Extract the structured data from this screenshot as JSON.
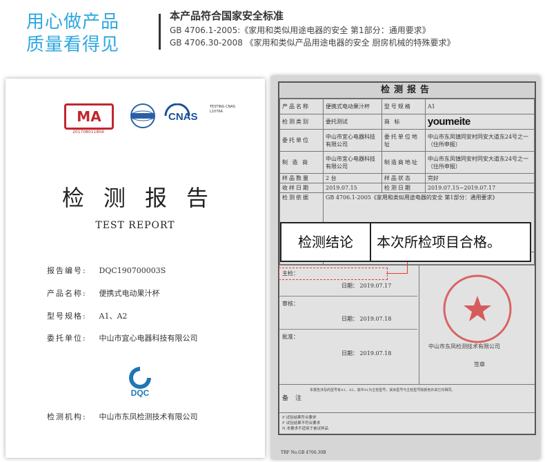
{
  "header": {
    "slogan_line1": "用心做产品",
    "slogan_line2": "质量看得见",
    "standards_title": "本产品符合国家安全标准",
    "standard_1": "GB 4706.1-2005:《家用和类似用途电器的安全 第1部分：通用要求》",
    "standard_2": "GB 4706.30-2008 《家用和类似产品用途电器的安全 厨房机械的特殊要求》"
  },
  "left_doc": {
    "cma_text": "MA",
    "cma_sub": "2017080118S6",
    "cnas_text": "CNAS",
    "cnas_sub": "TESTING CNAS L1076A",
    "title": "检测报告",
    "subtitle": "TEST REPORT",
    "fields": [
      {
        "key": "报告编号:",
        "value": "DQC190700003S"
      },
      {
        "key": "产品名称:",
        "value": "便携式电动果汁杯"
      },
      {
        "key": "型号规格:",
        "value": "A1、A2"
      },
      {
        "key": "委托单位:",
        "value": "中山市宜心电器科技有限公司"
      }
    ],
    "dqc_text": "DQC",
    "org_key": "检测机构:",
    "org_value": "中山市东凤检测技术有限公司"
  },
  "right_doc": {
    "title": "检测报告",
    "rows": [
      {
        "k1": "产品名称",
        "v1": "便携式电动果汁杯",
        "k2": "型号规格",
        "v2": "A1"
      },
      {
        "k1": "检测类别",
        "v1": "委托测试",
        "k2": "商 标",
        "v2": "youmeite"
      },
      {
        "k1": "委托单位",
        "v1": "中山市宜心电器科技有限公司",
        "k2": "委托单位地址",
        "v2": "中山市东凤镇同安村同安大道东24号之一（住所申报）"
      },
      {
        "k1": "制 造 商",
        "v1": "中山市宜心电器科技有限公司",
        "k2": "制造商地址",
        "v2": "中山市东凤镇同安村同安大道东24号之一（住所申报）"
      },
      {
        "k1": "样品数量",
        "v1": "2 台",
        "k2": "样品状态",
        "v2": "完好"
      },
      {
        "k1": "收样日期",
        "v1": "2019.07.15",
        "k2": "检测日期",
        "v2": "2019.07.15~2019.07.17"
      }
    ],
    "basis_key": "检测依据",
    "basis_value": "GB 4706.1-2005《家用和类似用途电器的安全 第1部分：通用要求》",
    "conclusion_key": "检测结论",
    "conclusion_value": "本次所检项目合格。",
    "sign_1_key": "主检：",
    "sign_1_date_key": "日期：",
    "sign_1_date": "2019.07.17",
    "sign_2_key": "审核：",
    "sign_2_date_key": "日期：",
    "sign_2_date": "2019.07.18",
    "sign_3_key": "批准：",
    "sign_3_date_key": "日期：",
    "sign_3_date": "2019.07.18",
    "stamp_org": "中山市东凤检测技术有限公司",
    "stamp_sign": "签章",
    "note_key": "备注",
    "note_text": "本报告涉及的型号有A1、A2，其中A1为主检型号，其余型号与主检型号除颜色外其它均相同。",
    "footer_notes": [
      "P  试验结果符合要求",
      "F  试验结果不符合要求",
      "N  本要求不适用于被试样品"
    ],
    "footer_no": "TRF No.GB 4706.30B"
  },
  "callout": {
    "label": "检测结论",
    "value": "本次所检项目合格。"
  }
}
